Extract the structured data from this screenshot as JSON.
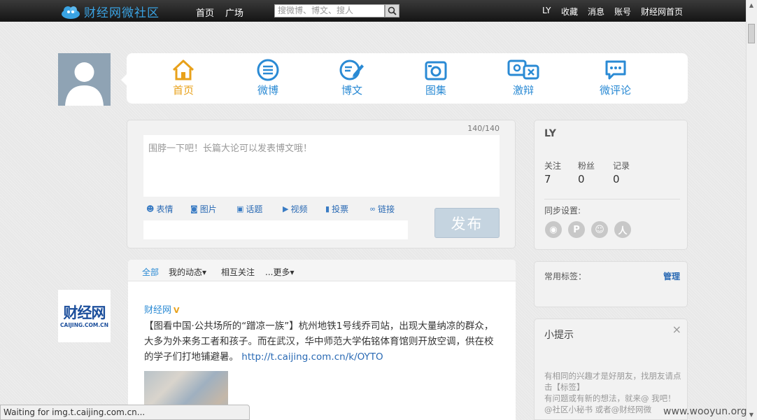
{
  "topbar": {
    "logo_text": "财经网微社区",
    "nav": [
      "首页",
      "广场"
    ],
    "search_placeholder": "搜微博、博文、搜人",
    "right": [
      "LY",
      "收藏",
      "消息",
      "账号",
      "财经网首页"
    ]
  },
  "mainnav": {
    "items": [
      "首页",
      "微博",
      "博文",
      "图集",
      "激辩",
      "微评论"
    ],
    "active": "首页"
  },
  "composer": {
    "counter": "140/140",
    "placeholder": "围脖一下吧！长篇大论可以发表博文哦！",
    "tools": [
      "表情",
      "图片",
      "话题",
      "视频",
      "投票",
      "链接"
    ],
    "publish_label": "发布"
  },
  "feed": {
    "tabs": [
      "全部",
      "我的动态",
      "相互关注",
      "...更多"
    ],
    "post": {
      "author": "财经网",
      "badge": "V",
      "text": "【图看中国·公共场所的“蹭凉一族”】杭州地铁1号线乔司站，出现大量纳凉的群众，大多为外来务工者和孩子。而在武汉，华中师范大学佑铭体育馆则开放空调，供在校的学子们打地铺避暑。 ",
      "link": "http://t.caijing.com.cn/k/OYTO"
    },
    "caijing_logo": "财经网",
    "caijing_domain": "CAIJING.COM.CN"
  },
  "profile": {
    "name": "LY",
    "stats": [
      {
        "label": "关注",
        "value": "7"
      },
      {
        "label": "粉丝",
        "value": "0"
      },
      {
        "label": "记录",
        "value": "0"
      }
    ],
    "sync_label": "同步设置:"
  },
  "tags": {
    "label": "常用标签：",
    "manage": "管理"
  },
  "tips": {
    "title": "小提示",
    "close": "×",
    "line1": "有相同的兴趣才是好朋友，找朋友请点击【标签】",
    "line2": "有问题或有新的想法，就来@ 我吧！@社区小秘书 或者@财经网微"
  },
  "status_text": "Waiting for img.t.caijing.com.cn...",
  "watermark": "www.wooyun.org",
  "colors": {
    "accent_blue": "#2a8ad4",
    "active_orange": "#e8a11a",
    "topbar_dark": "#1e1e1e"
  }
}
